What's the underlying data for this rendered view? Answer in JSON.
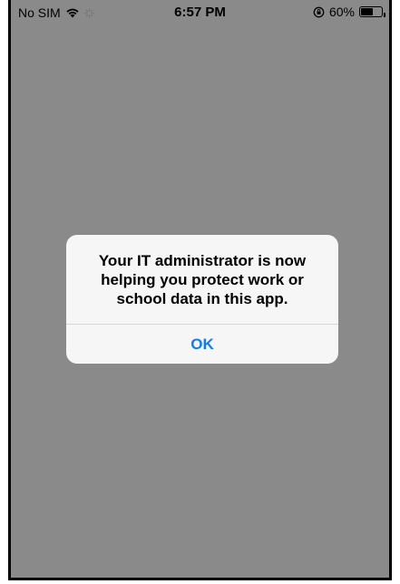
{
  "status_bar": {
    "carrier": "No SIM",
    "time": "6:57 PM",
    "battery_percent": "60%",
    "battery_level": 0.6,
    "icons": [
      "wifi-icon",
      "activity-spinner-icon",
      "orientation-lock-icon",
      "battery-icon"
    ]
  },
  "alert": {
    "message_line1": "Your IT administrator is now",
    "message_line2": "helping you protect work or",
    "message_line3": "school data in this app.",
    "ok_label": "OK"
  },
  "colors": {
    "background_dim": "#8a8a8a",
    "alert_background": "#f6f6f6",
    "button_blue": "#0a7aff"
  }
}
